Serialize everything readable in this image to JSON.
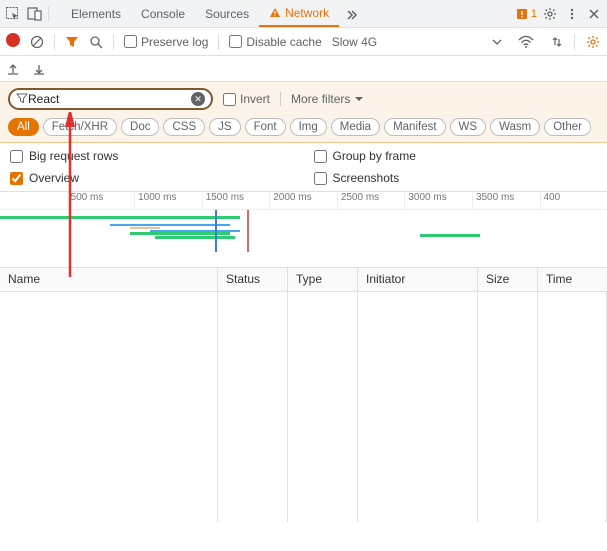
{
  "topbar": {
    "tabs": [
      "Elements",
      "Console",
      "Sources",
      "Network"
    ],
    "active_tab": "Network",
    "issue_count": "1"
  },
  "toolbar": {
    "preserve_log": "Preserve log",
    "disable_cache": "Disable cache",
    "throttle": "Slow 4G"
  },
  "filter": {
    "value": "React",
    "invert": "Invert",
    "more_filters": "More filters",
    "types": [
      "All",
      "Fetch/XHR",
      "Doc",
      "CSS",
      "JS",
      "Font",
      "Img",
      "Media",
      "Manifest",
      "WS",
      "Wasm",
      "Other"
    ],
    "active_type": "All"
  },
  "options": {
    "big_rows": "Big request rows",
    "overview": "Overview",
    "group_frame": "Group by frame",
    "screenshots": "Screenshots"
  },
  "timeline_ticks": [
    "500 ms",
    "1000 ms",
    "1500 ms",
    "2000 ms",
    "2500 ms",
    "3000 ms",
    "3500 ms",
    "400"
  ],
  "table": {
    "headers": {
      "name": "Name",
      "status": "Status",
      "type": "Type",
      "initiator": "Initiator",
      "size": "Size",
      "time": "Time"
    }
  }
}
